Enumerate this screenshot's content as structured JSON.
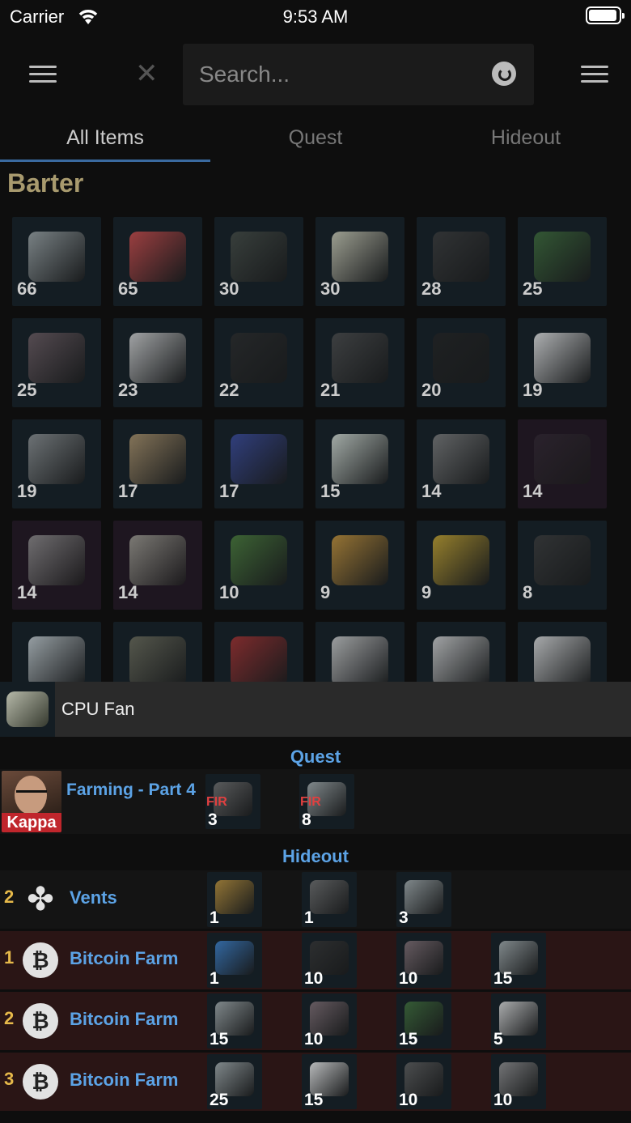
{
  "status": {
    "carrier": "Carrier",
    "time": "9:53 AM"
  },
  "search": {
    "placeholder": "Search..."
  },
  "tabs": [
    {
      "label": "All Items",
      "active": true
    },
    {
      "label": "Quest",
      "active": false
    },
    {
      "label": "Hideout",
      "active": false
    }
  ],
  "section": {
    "title": "Barter"
  },
  "grid": [
    {
      "count": "66",
      "color": "#9aa2a4"
    },
    {
      "count": "65",
      "color": "#c84a4a"
    },
    {
      "count": "30",
      "color": "#444a44"
    },
    {
      "count": "30",
      "color": "#c8c8b4"
    },
    {
      "count": "28",
      "color": "#3a3a3a"
    },
    {
      "count": "25",
      "color": "#3d6a3a"
    },
    {
      "count": "25",
      "color": "#6a5a60"
    },
    {
      "count": "23",
      "color": "#cfcfcf"
    },
    {
      "count": "22",
      "color": "#2a2a2a"
    },
    {
      "count": "21",
      "color": "#4a4a4a"
    },
    {
      "count": "20",
      "color": "#222222"
    },
    {
      "count": "19",
      "color": "#e0e0e0"
    },
    {
      "count": "19",
      "color": "#8a8e90"
    },
    {
      "count": "17",
      "color": "#a8906a"
    },
    {
      "count": "17",
      "color": "#3a4a9a"
    },
    {
      "count": "15",
      "color": "#d0d8d0"
    },
    {
      "count": "14",
      "color": "#7a7a7a"
    },
    {
      "count": "14",
      "color": "#2e2630",
      "pink": true
    },
    {
      "count": "14",
      "color": "#8a8a8a",
      "pink": true
    },
    {
      "count": "14",
      "color": "#9a9a90",
      "pink": true
    },
    {
      "count": "10",
      "color": "#4a7a3a"
    },
    {
      "count": "9",
      "color": "#c0903a"
    },
    {
      "count": "9",
      "color": "#c0a030"
    },
    {
      "count": "8",
      "color": "#3a3a3a"
    },
    {
      "count": "",
      "color": "#c0c8cc"
    },
    {
      "count": "",
      "color": "#6a6a5a"
    },
    {
      "count": "",
      "color": "#a03030"
    },
    {
      "count": "",
      "color": "#c8c8c8"
    },
    {
      "count": "",
      "color": "#cfcfcf"
    },
    {
      "count": "",
      "color": "#d8d8d8"
    }
  ],
  "detail": {
    "title": "CPU Fan",
    "quest_heading": "Quest",
    "hideout_heading": "Hideout",
    "quest": {
      "name": "Farming - Part 4",
      "badge": "Kappa",
      "items": [
        {
          "count": "3",
          "fir": "FIR",
          "color": "#6a6a6a"
        },
        {
          "count": "8",
          "fir": "FIR",
          "color": "#9aa2a4"
        }
      ]
    },
    "hideout": [
      {
        "level": "2",
        "name": "Vents",
        "icon": "fan-icon",
        "items": [
          {
            "count": "1",
            "color": "#b08a3a"
          },
          {
            "count": "1",
            "color": "#6a6a6a"
          },
          {
            "count": "3",
            "color": "#9aa2a4"
          }
        ]
      },
      {
        "level": "1",
        "name": "Bitcoin Farm",
        "icon": "bitcoin-icon",
        "items": [
          {
            "count": "1",
            "color": "#3a7ac0"
          },
          {
            "count": "10",
            "color": "#333333"
          },
          {
            "count": "10",
            "color": "#7a6a70"
          },
          {
            "count": "15",
            "color": "#9aa2a4"
          }
        ]
      },
      {
        "level": "2",
        "name": "Bitcoin Farm",
        "icon": "bitcoin-icon",
        "items": [
          {
            "count": "15",
            "color": "#9aa2a4"
          },
          {
            "count": "10",
            "color": "#7a6a70"
          },
          {
            "count": "15",
            "color": "#3d6a3a"
          },
          {
            "count": "5",
            "color": "#cfcfcf"
          }
        ]
      },
      {
        "level": "3",
        "name": "Bitcoin Farm",
        "icon": "bitcoin-icon",
        "items": [
          {
            "count": "25",
            "color": "#9aa2a4"
          },
          {
            "count": "15",
            "color": "#e0e0e0"
          },
          {
            "count": "10",
            "color": "#5a5a5a"
          },
          {
            "count": "10",
            "color": "#8a8a8a"
          }
        ]
      }
    ]
  }
}
